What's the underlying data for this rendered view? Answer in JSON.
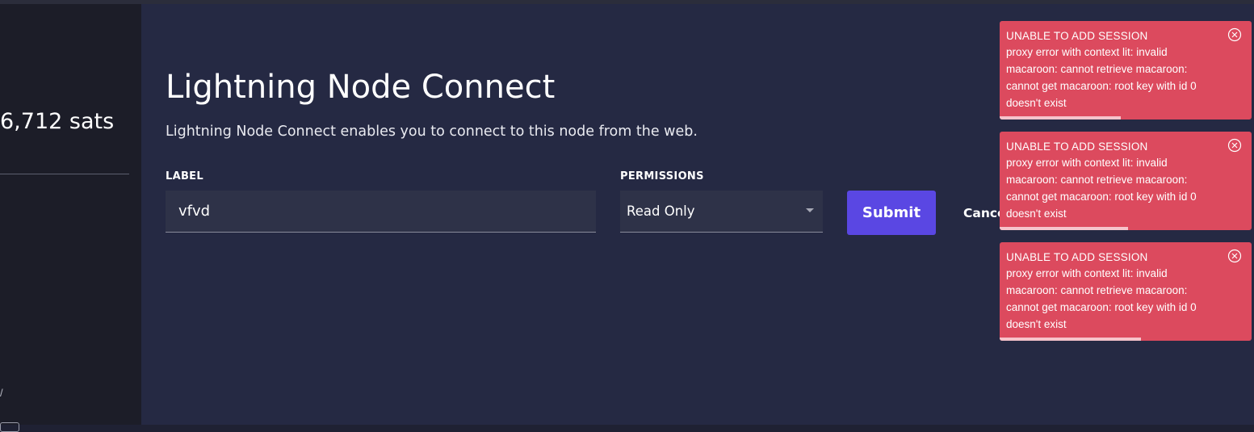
{
  "sidebar": {
    "balance": "6,712 sats",
    "glyph": "/"
  },
  "main": {
    "title": "Lightning Node Connect",
    "description": "Lightning Node Connect enables you to connect to this node from the web.",
    "form": {
      "label_heading": "LABEL",
      "label_value": "vfvd",
      "permissions_heading": "PERMISSIONS",
      "permissions_value": "Read Only",
      "submit_label": "Submit",
      "cancel_label": "Cance"
    }
  },
  "toasts": [
    {
      "title": "UNABLE TO ADD SESSION",
      "message": "proxy error with context lit: invalid macaroon: cannot retrieve macaroon: cannot get macaroon: root key with id 0 doesn't exist",
      "progress": 0.48
    },
    {
      "title": "UNABLE TO ADD SESSION",
      "message": "proxy error with context lit: invalid macaroon: cannot retrieve macaroon: cannot get macaroon: root key with id 0 doesn't exist",
      "progress": 0.51
    },
    {
      "title": "UNABLE TO ADD SESSION",
      "message": "proxy error with context lit: invalid macaroon: cannot retrieve macaroon: cannot get macaroon: root key with id 0 doesn't exist",
      "progress": 0.56
    }
  ],
  "colors": {
    "toast_bg": "#dc4a5e",
    "submit_bg": "#5a47e3",
    "main_bg": "#252943",
    "sidebar_bg": "#1c1d28"
  }
}
